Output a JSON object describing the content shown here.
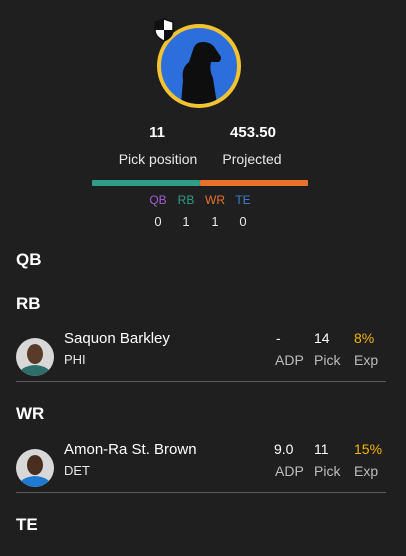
{
  "header": {
    "pick_position_value": "11",
    "pick_position_label": "Pick position",
    "projected_value": "453.50",
    "projected_label": "Projected"
  },
  "position_summary": [
    {
      "label": "QB",
      "count": "0",
      "color": "#a05cd6"
    },
    {
      "label": "RB",
      "count": "1",
      "color": "#2e9e86"
    },
    {
      "label": "WR",
      "count": "1",
      "color": "#e8712c"
    },
    {
      "label": "TE",
      "count": "0",
      "color": "#3f7fd6"
    }
  ],
  "colors": {
    "avatar_border": "#f4c430",
    "avatar_bg": "#2c6fdc",
    "exp_value": "#f4b400",
    "bar_rb": "#2e9e86",
    "bar_wr": "#e8712c"
  },
  "sections": {
    "qb": "QB",
    "rb": "RB",
    "wr": "WR",
    "te": "TE"
  },
  "players": [
    {
      "name": "Saquon Barkley",
      "team": "PHI",
      "adp": "-",
      "adp_label": "ADP",
      "pick": "14",
      "pick_label": "Pick",
      "exp": "8%",
      "exp_label": "Exp",
      "jersey_color": "#2e6e6a"
    },
    {
      "name": "Amon-Ra St. Brown",
      "team": "DET",
      "adp": "9.0",
      "adp_label": "ADP",
      "pick": "11",
      "pick_label": "Pick",
      "exp": "15%",
      "exp_label": "Exp",
      "jersey_color": "#1e7ad1"
    }
  ]
}
